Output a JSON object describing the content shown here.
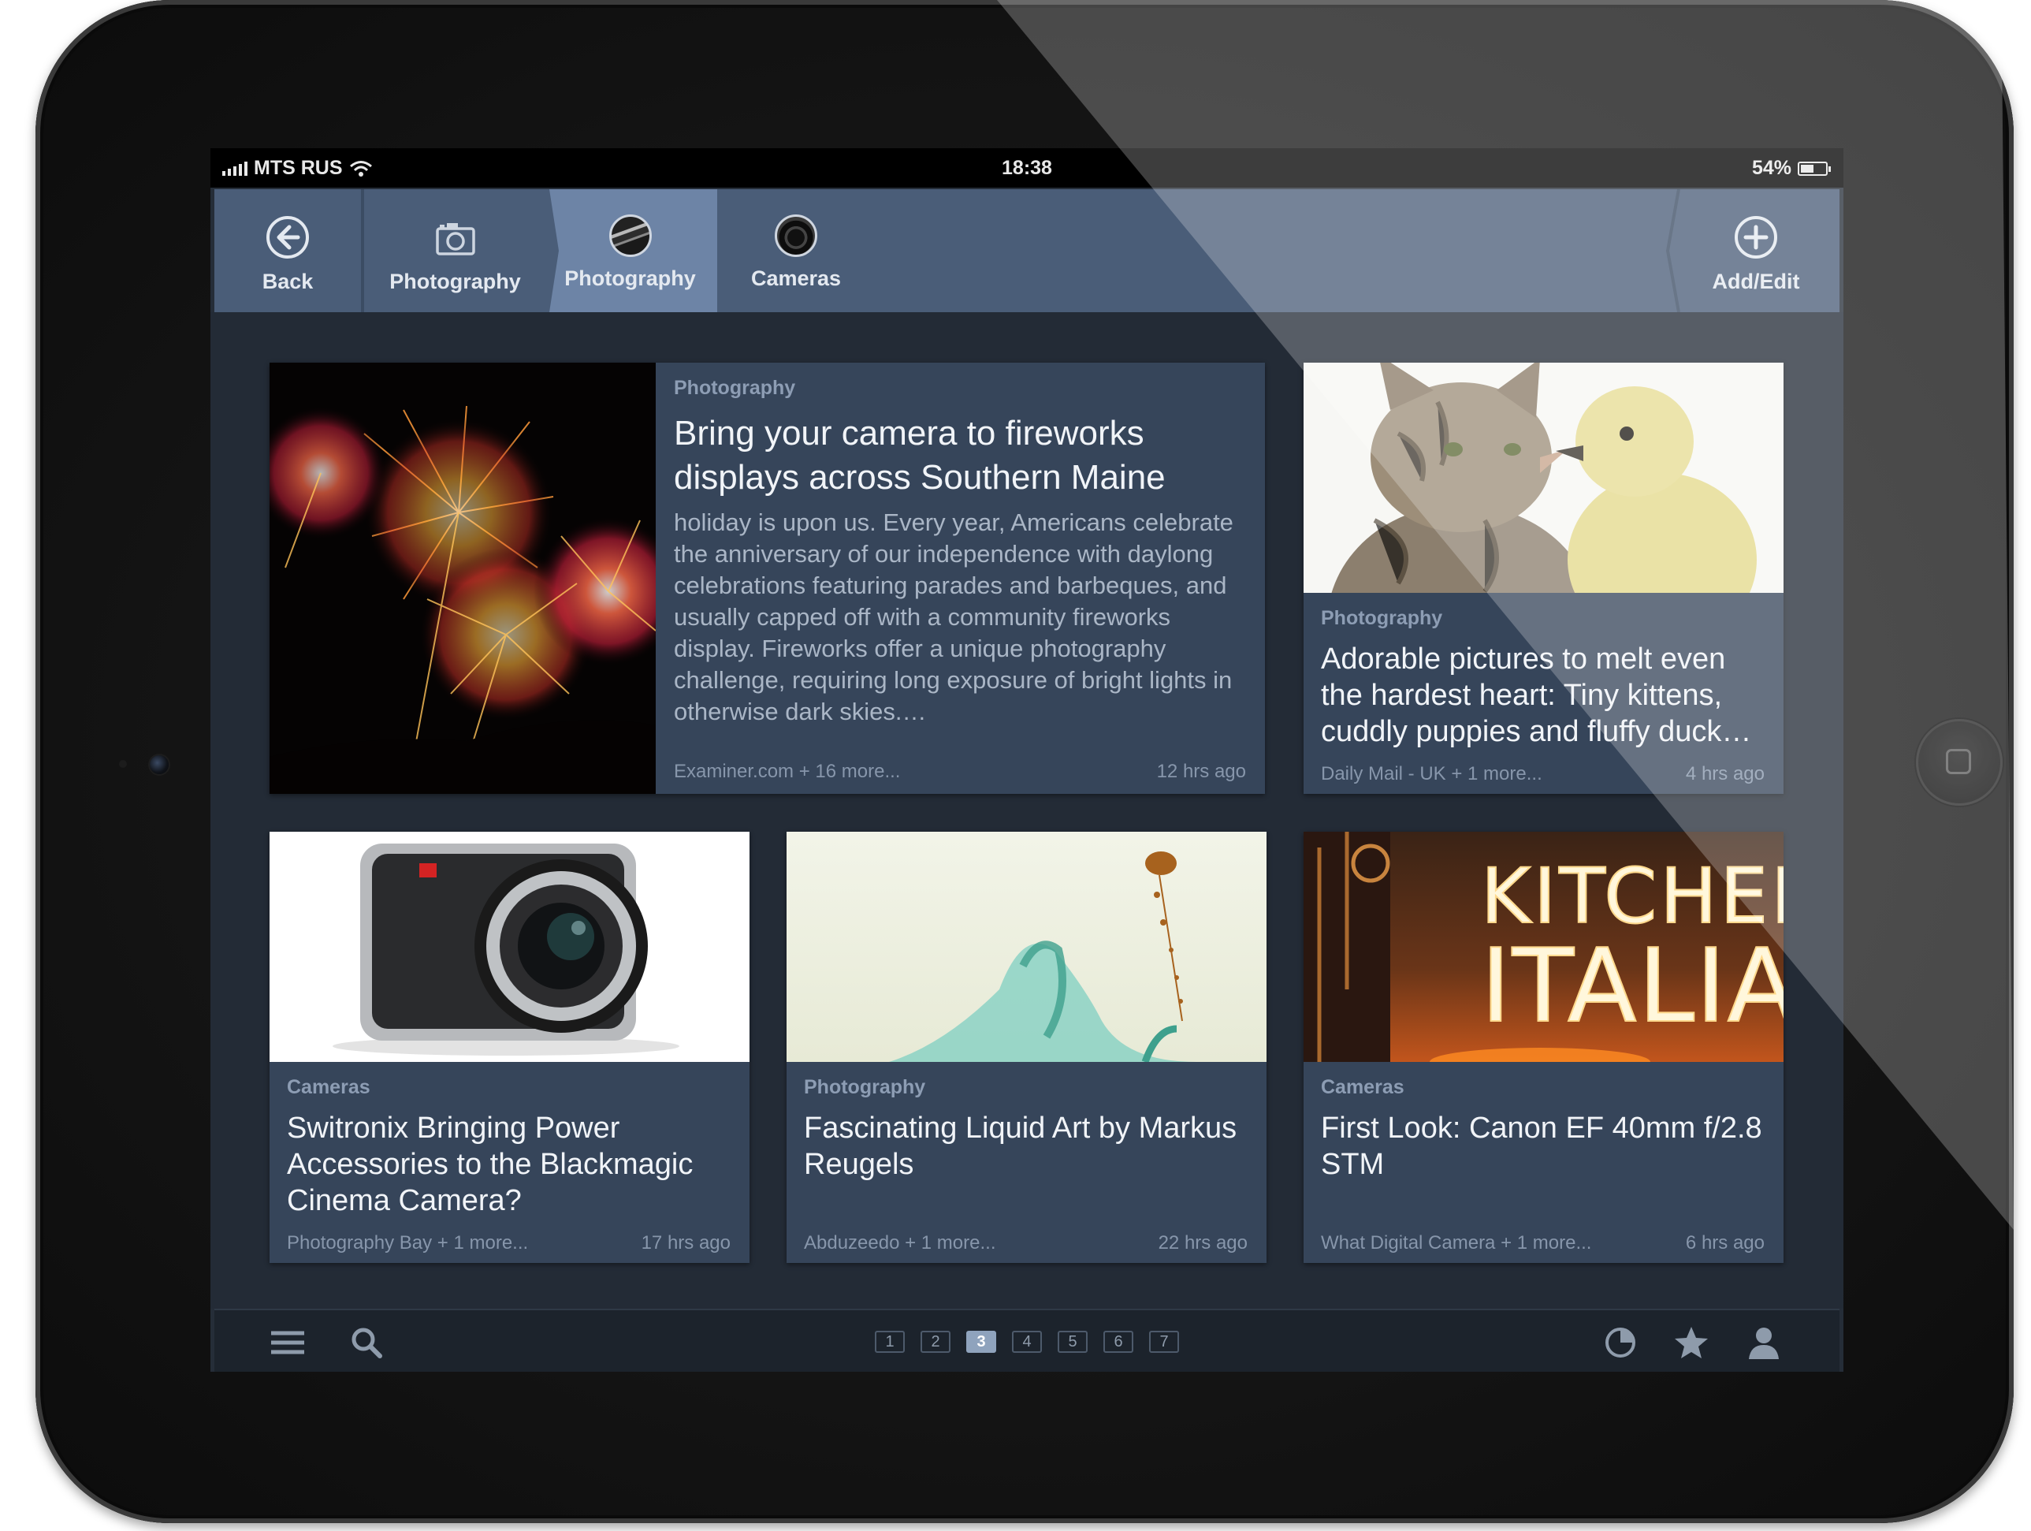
{
  "status_bar": {
    "carrier": "MTS RUS",
    "time": "18:38",
    "battery": "54%",
    "battery_level": 0.54
  },
  "nav": {
    "back_label": "Back",
    "tabs": [
      {
        "label": "Photography",
        "icon": "camera-icon"
      },
      {
        "label": "Photography",
        "icon": "photography-thumb-icon",
        "active": true
      },
      {
        "label": "Cameras",
        "icon": "cameras-thumb-icon"
      }
    ],
    "add_label": "Add/Edit"
  },
  "articles": [
    {
      "category": "Photography",
      "title": "Bring your camera to fireworks displays across Southern Maine",
      "excerpt": "holiday is upon us. Every year, Americans celebrate the anniversary of our independence with daylong celebrations featuring parades and barbeques, and usually capped off with a community fireworks display. Fireworks offer a unique photography challenge, requiring long exposure of bright lights in otherwise dark skies.…",
      "source": "Examiner.com + 16 more...",
      "time": "12 hrs ago",
      "image": "fireworks"
    },
    {
      "category": "Photography",
      "title": "Adorable pictures to melt even the hardest heart: Tiny kittens, cuddly puppies and fluffy duck…",
      "source": "Daily Mail - UK + 1 more...",
      "time": "4 hrs ago",
      "image": "kitten-and-duckling"
    },
    {
      "category": "Cameras",
      "title": "Switronix Bringing Power Accessories to the Blackmagic Cinema Camera?",
      "source": "Photography Bay + 1 more...",
      "time": "17 hrs ago",
      "image": "blackmagic-cinema-camera"
    },
    {
      "category": "Photography",
      "title": "Fascinating Liquid Art by Markus Reugels",
      "source": "Abduzeedo + 1 more...",
      "time": "22 hrs ago",
      "image": "liquid-splash"
    },
    {
      "category": "Cameras",
      "title": "First Look: Canon EF 40mm f/2.8 STM",
      "source": "What Digital Camera + 1 more...",
      "time": "6 hrs ago",
      "image": "kitchen-italia-neon",
      "image_text": [
        "KITCHEN",
        "ITALIA"
      ]
    }
  ],
  "pagination": {
    "pages": [
      "1",
      "2",
      "3",
      "4",
      "5",
      "6",
      "7"
    ],
    "current": "3"
  },
  "bottom_icons": [
    "menu-icon",
    "search-icon",
    "pie-chart-icon",
    "star-icon",
    "profile-icon"
  ],
  "colors": {
    "nav_bg": "#4a5d78",
    "nav_active": "#6d84a6",
    "card_bg": "#36455a",
    "screen_bg": "#232b36"
  }
}
